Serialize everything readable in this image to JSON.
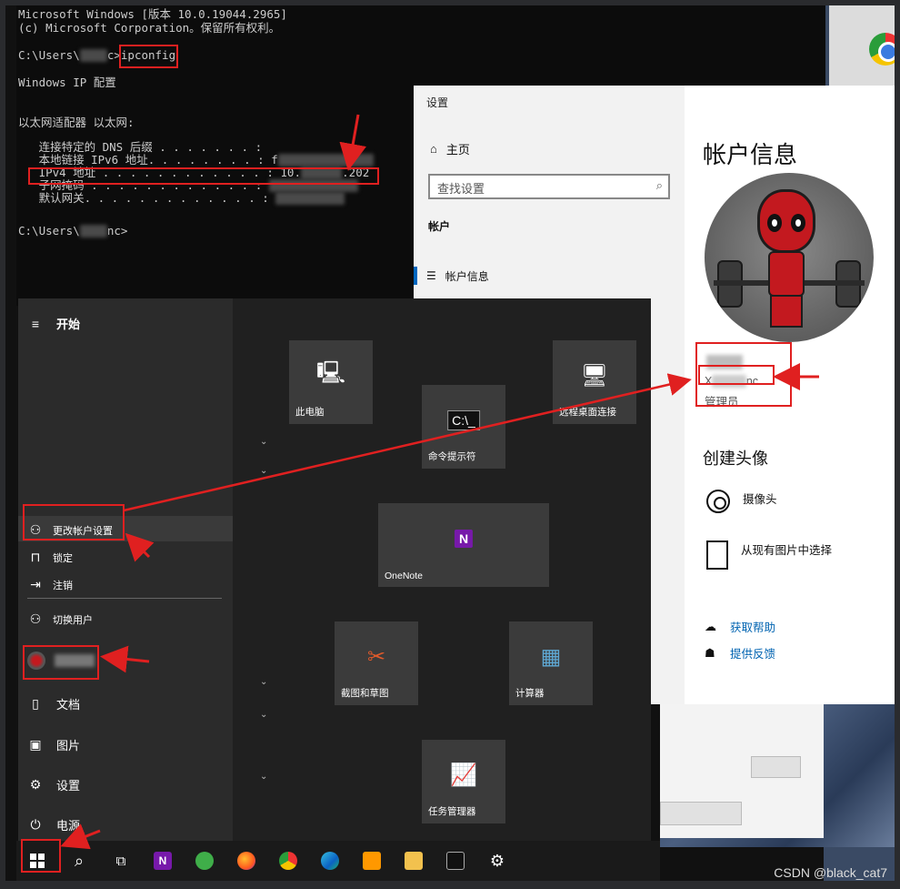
{
  "cmd": {
    "line1": "Microsoft Windows [版本 10.0.19044.2965]",
    "line2": "(c) Microsoft Corporation。保留所有权利。",
    "prompt1_prefix": "C:\\Users\\",
    "prompt1_suffix": "c>",
    "command": "ipconfig",
    "line_ipcfg": "Windows IP 配置",
    "adapter": "以太网适配器 以太网:",
    "dns": "   连接特定的 DNS 后缀 . . . . . . . :",
    "ipv6": "   本地链接 IPv6 地址. . . . . . . . : f",
    "ipv4_label": "IPv4 地址 . . . . . . . . . . . . :",
    "ipv4_prefix": "10.",
    "ipv4_suffix": ".202",
    "mask": "   子网掩码 . . . . . . . . . . . . :",
    "gateway": "   默认网关. . . . . . . . . . . . . :",
    "prompt2_prefix": "C:\\Users\\",
    "prompt2_suffix": "nc>"
  },
  "settings": {
    "window_title": "设置",
    "home": "主页",
    "search_placeholder": "查找设置",
    "section": "帐户",
    "nav_item": "帐户信息",
    "heading": "帐户信息",
    "email_prefix": "X",
    "email_suffix": "nc",
    "role": "管理员",
    "create_avatar": "创建头像",
    "camera": "摄像头",
    "from_pictures": "从现有图片中选择",
    "get_help": "获取帮助",
    "feedback": "提供反馈"
  },
  "start": {
    "header": "开始",
    "change_account": "更改帐户设置",
    "lock": "锁定",
    "signout": "注销",
    "switch_user": "切换用户",
    "documents": "文档",
    "pictures": "图片",
    "settings": "设置",
    "power": "电源",
    "tiles": {
      "this_pc": "此电脑",
      "cmd": "命令提示符",
      "remote_desktop": "远程桌面连接",
      "onenote": "OneNote",
      "snipping": "截图和草图",
      "calculator": "计算器",
      "task_manager": "任务管理器"
    }
  },
  "icons": [
    "windows-start-icon",
    "search-icon",
    "task-view-icon",
    "onenote-icon",
    "360-browser-icon",
    "firefox-icon",
    "chrome-icon",
    "edge-icon",
    "sublime-icon",
    "file-explorer-icon",
    "cmd-icon",
    "settings-gear-icon"
  ],
  "watermark": "CSDN @black_cat7",
  "colors": {
    "highlight_red": "#e02020",
    "link_blue": "#0063b1",
    "accent_blue": "#0067c0"
  }
}
